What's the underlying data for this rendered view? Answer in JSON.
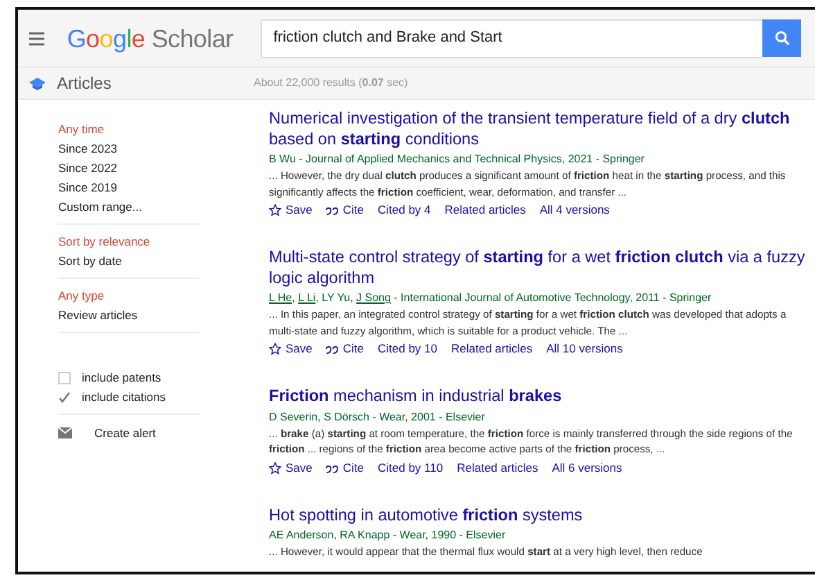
{
  "header": {
    "logo": "Google",
    "logo_suffix": "Scholar",
    "search": {
      "value": "friction clutch and Brake and Start"
    }
  },
  "subbar": {
    "label": "Articles",
    "results": "About 22,000 results (**0.07** sec)"
  },
  "sidebar": {
    "groups": [
      {
        "items": [
          {
            "label": "Any time",
            "selected": true
          },
          {
            "label": "Since 2023",
            "selected": false
          },
          {
            "label": "Since 2022",
            "selected": false
          },
          {
            "label": "Since 2019",
            "selected": false
          },
          {
            "label": "Custom range...",
            "selected": false
          }
        ]
      },
      {
        "items": [
          {
            "label": "Sort by relevance",
            "selected": true
          },
          {
            "label": "Sort by date",
            "selected": false
          }
        ]
      },
      {
        "items": [
          {
            "label": "Any type",
            "selected": true
          },
          {
            "label": "Review articles",
            "selected": false
          }
        ]
      }
    ],
    "checkboxes": [
      {
        "label": "include patents",
        "checked": false
      },
      {
        "label": "include citations",
        "checked": true
      }
    ],
    "alert": "Create alert"
  },
  "results": [
    {
      "title": "Numerical investigation of the transient temperature field of a dry **clutch** based on **starting** conditions",
      "source": [
        {
          "text": "B Wu - Journal of Applied Mechanics and Technical Physics, 2021 - Springer",
          "linked": false
        }
      ],
      "snippet": "... However, the dry dual **clutch** produces a significant amount of **friction** heat in the **starting** process, and this significantly affects the **friction** coefficient, wear, deformation, and transfer ...",
      "actions": [
        "Save",
        "Cite",
        "Cited by 4",
        "Related articles",
        "All 4 versions"
      ]
    },
    {
      "title": "Multi-state control strategy of **starting** for a wet **friction clutch** via a fuzzy logic algorithm",
      "source": [
        {
          "text": "L He",
          "linked": true
        },
        {
          "text": ", ",
          "linked": false
        },
        {
          "text": "L Li",
          "linked": true
        },
        {
          "text": ", LY Yu, ",
          "linked": false
        },
        {
          "text": "J Song",
          "linked": true
        },
        {
          "text": " - International Journal of Automotive Technology, 2011 - Springer",
          "linked": false
        }
      ],
      "snippet": "... In this paper, an integrated control strategy of **starting** for a wet **friction clutch** was developed that adopts a multi-state and fuzzy algorithm, which is suitable for a product vehicle. The ...",
      "actions": [
        "Save",
        "Cite",
        "Cited by 10",
        "Related articles",
        "All 10 versions"
      ]
    },
    {
      "title": "**Friction** mechanism in industrial **brakes**",
      "source": [
        {
          "text": "D Severin, S Dörsch - Wear, 2001 - Elsevier",
          "linked": false
        }
      ],
      "snippet": "... **brake** (a) **starting** at room temperature, the **friction** force is mainly transferred through the side regions of the **friction** ... regions of the **friction** area become active parts of the **friction** process, ...",
      "actions": [
        "Save",
        "Cite",
        "Cited by 110",
        "Related articles",
        "All 6 versions"
      ]
    },
    {
      "title": "Hot spotting in automotive **friction** systems",
      "source": [
        {
          "text": "AE Anderson, RA Knapp - Wear, 1990 - Elsevier",
          "linked": false
        }
      ],
      "snippet": "... However, it would appear that the thermal flux would **start** at a very high level, then reduce"
    }
  ]
}
